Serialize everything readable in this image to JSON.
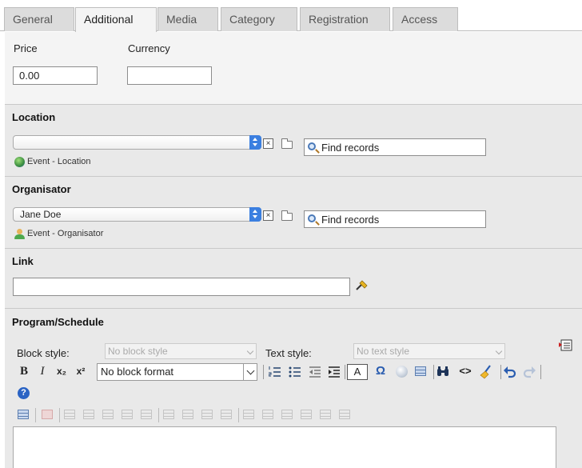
{
  "tabs": [
    {
      "label": "General",
      "active": false
    },
    {
      "label": "Additional",
      "active": true
    },
    {
      "label": "Media",
      "active": false
    },
    {
      "label": "Category",
      "active": false
    },
    {
      "label": "Registration",
      "active": false
    },
    {
      "label": "Access",
      "active": false
    }
  ],
  "price": {
    "label": "Price",
    "value": "0.00"
  },
  "currency": {
    "label": "Currency",
    "value": ""
  },
  "location": {
    "heading": "Location",
    "selected": "",
    "clear_symbol": "×",
    "find_label": "Find records",
    "table_label": "Event - Location"
  },
  "organisator": {
    "heading": "Organisator",
    "selected": "Jane Doe",
    "clear_symbol": "×",
    "find_label": "Find records",
    "table_label": "Event - Organisator"
  },
  "link": {
    "heading": "Link",
    "value": ""
  },
  "program": {
    "heading": "Program/Schedule",
    "block_style_label": "Block style:",
    "block_style_value": "No block style",
    "text_style_label": "Text style:",
    "text_style_value": "No text style",
    "block_format_value": "No block format",
    "buttons": {
      "bold": "B",
      "italic": "I",
      "subscript": "x₂",
      "superscript": "x²",
      "char": "A",
      "omega": "Ω",
      "help": "?"
    }
  },
  "colors": {
    "accent": "#3b7fe0",
    "panel": "#e9e9e9",
    "tab_inactive": "#dcdcdc"
  }
}
